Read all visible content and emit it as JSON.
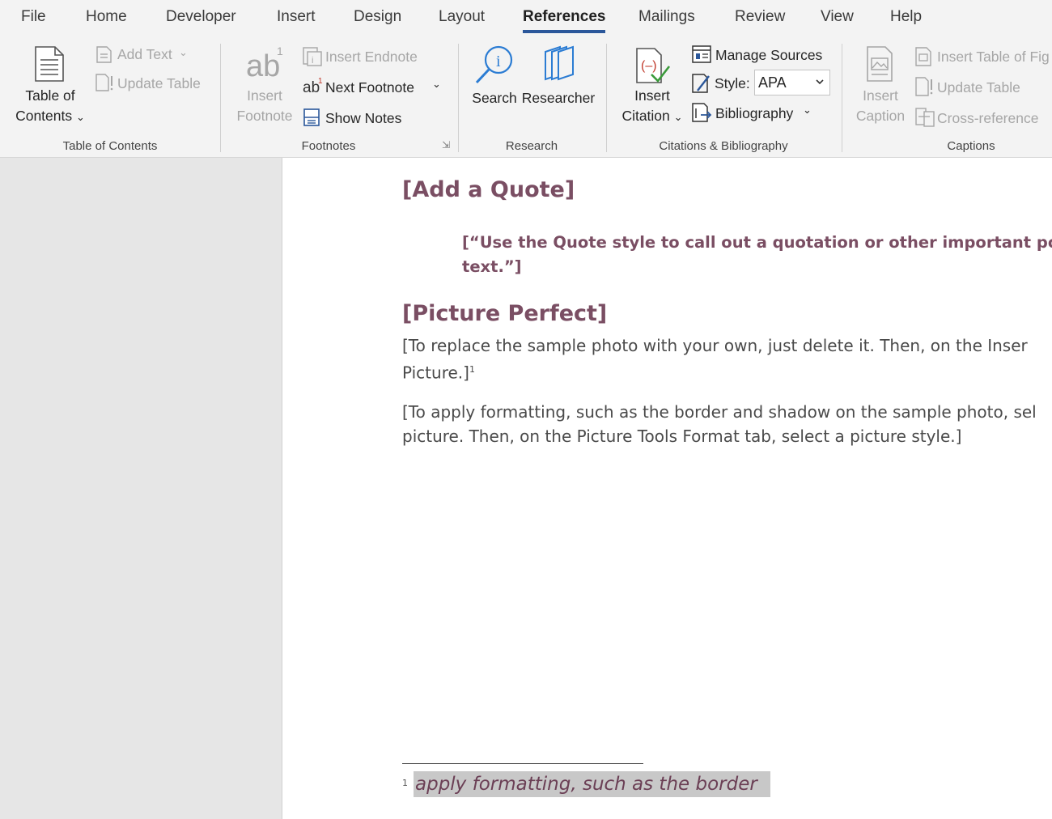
{
  "tabs": [
    "File",
    "Home",
    "Developer",
    "Insert",
    "Design",
    "Layout",
    "References",
    "Mailings",
    "Review",
    "View",
    "Help"
  ],
  "active_tab": "References",
  "accent_color": "#2b579a",
  "ribbon": {
    "toc": {
      "big_button_line1": "Table of",
      "big_button_line2": "Contents",
      "add_text": "Add Text",
      "update_table": "Update Table",
      "group_label": "Table of Contents"
    },
    "footnotes": {
      "insert_footnote_line1": "Insert",
      "insert_footnote_line2": "Footnote",
      "insert_endnote": "Insert Endnote",
      "next_footnote": "Next Footnote",
      "show_notes": "Show Notes",
      "group_label": "Footnotes"
    },
    "research": {
      "search": "Search",
      "researcher": "Researcher",
      "group_label": "Research"
    },
    "citations": {
      "insert_citation_line1": "Insert",
      "insert_citation_line2": "Citation",
      "manage_sources": "Manage Sources",
      "style_label": "Style:",
      "style_value": "APA",
      "bibliography": "Bibliography",
      "group_label": "Citations & Bibliography"
    },
    "captions": {
      "insert_caption_line1": "Insert",
      "insert_caption_line2": "Caption",
      "insert_table_of_figures": "Insert Table of Fig",
      "update_table": "Update Table",
      "cross_reference": "Cross-reference",
      "group_label": "Captions"
    }
  },
  "document": {
    "heading_quote": "[Add a Quote]",
    "quote_line1": "[“Use the Quote style to call out a quotation or other important poi",
    "quote_line2": "text.”]",
    "heading_picture": "[Picture Perfect]",
    "para1_line1": "[To replace the sample photo with your own, just delete it. Then, on the Inser",
    "para1_line2": "Picture.]",
    "para1_sup": "1",
    "para2_line1": "[To apply formatting, such as the border and shadow on the sample photo, sel",
    "para2_line2": "picture. Then, on the Picture Tools Format tab, select a picture style.]",
    "footnote_number": "1",
    "footnote_text": "apply formatting, such as the border"
  }
}
